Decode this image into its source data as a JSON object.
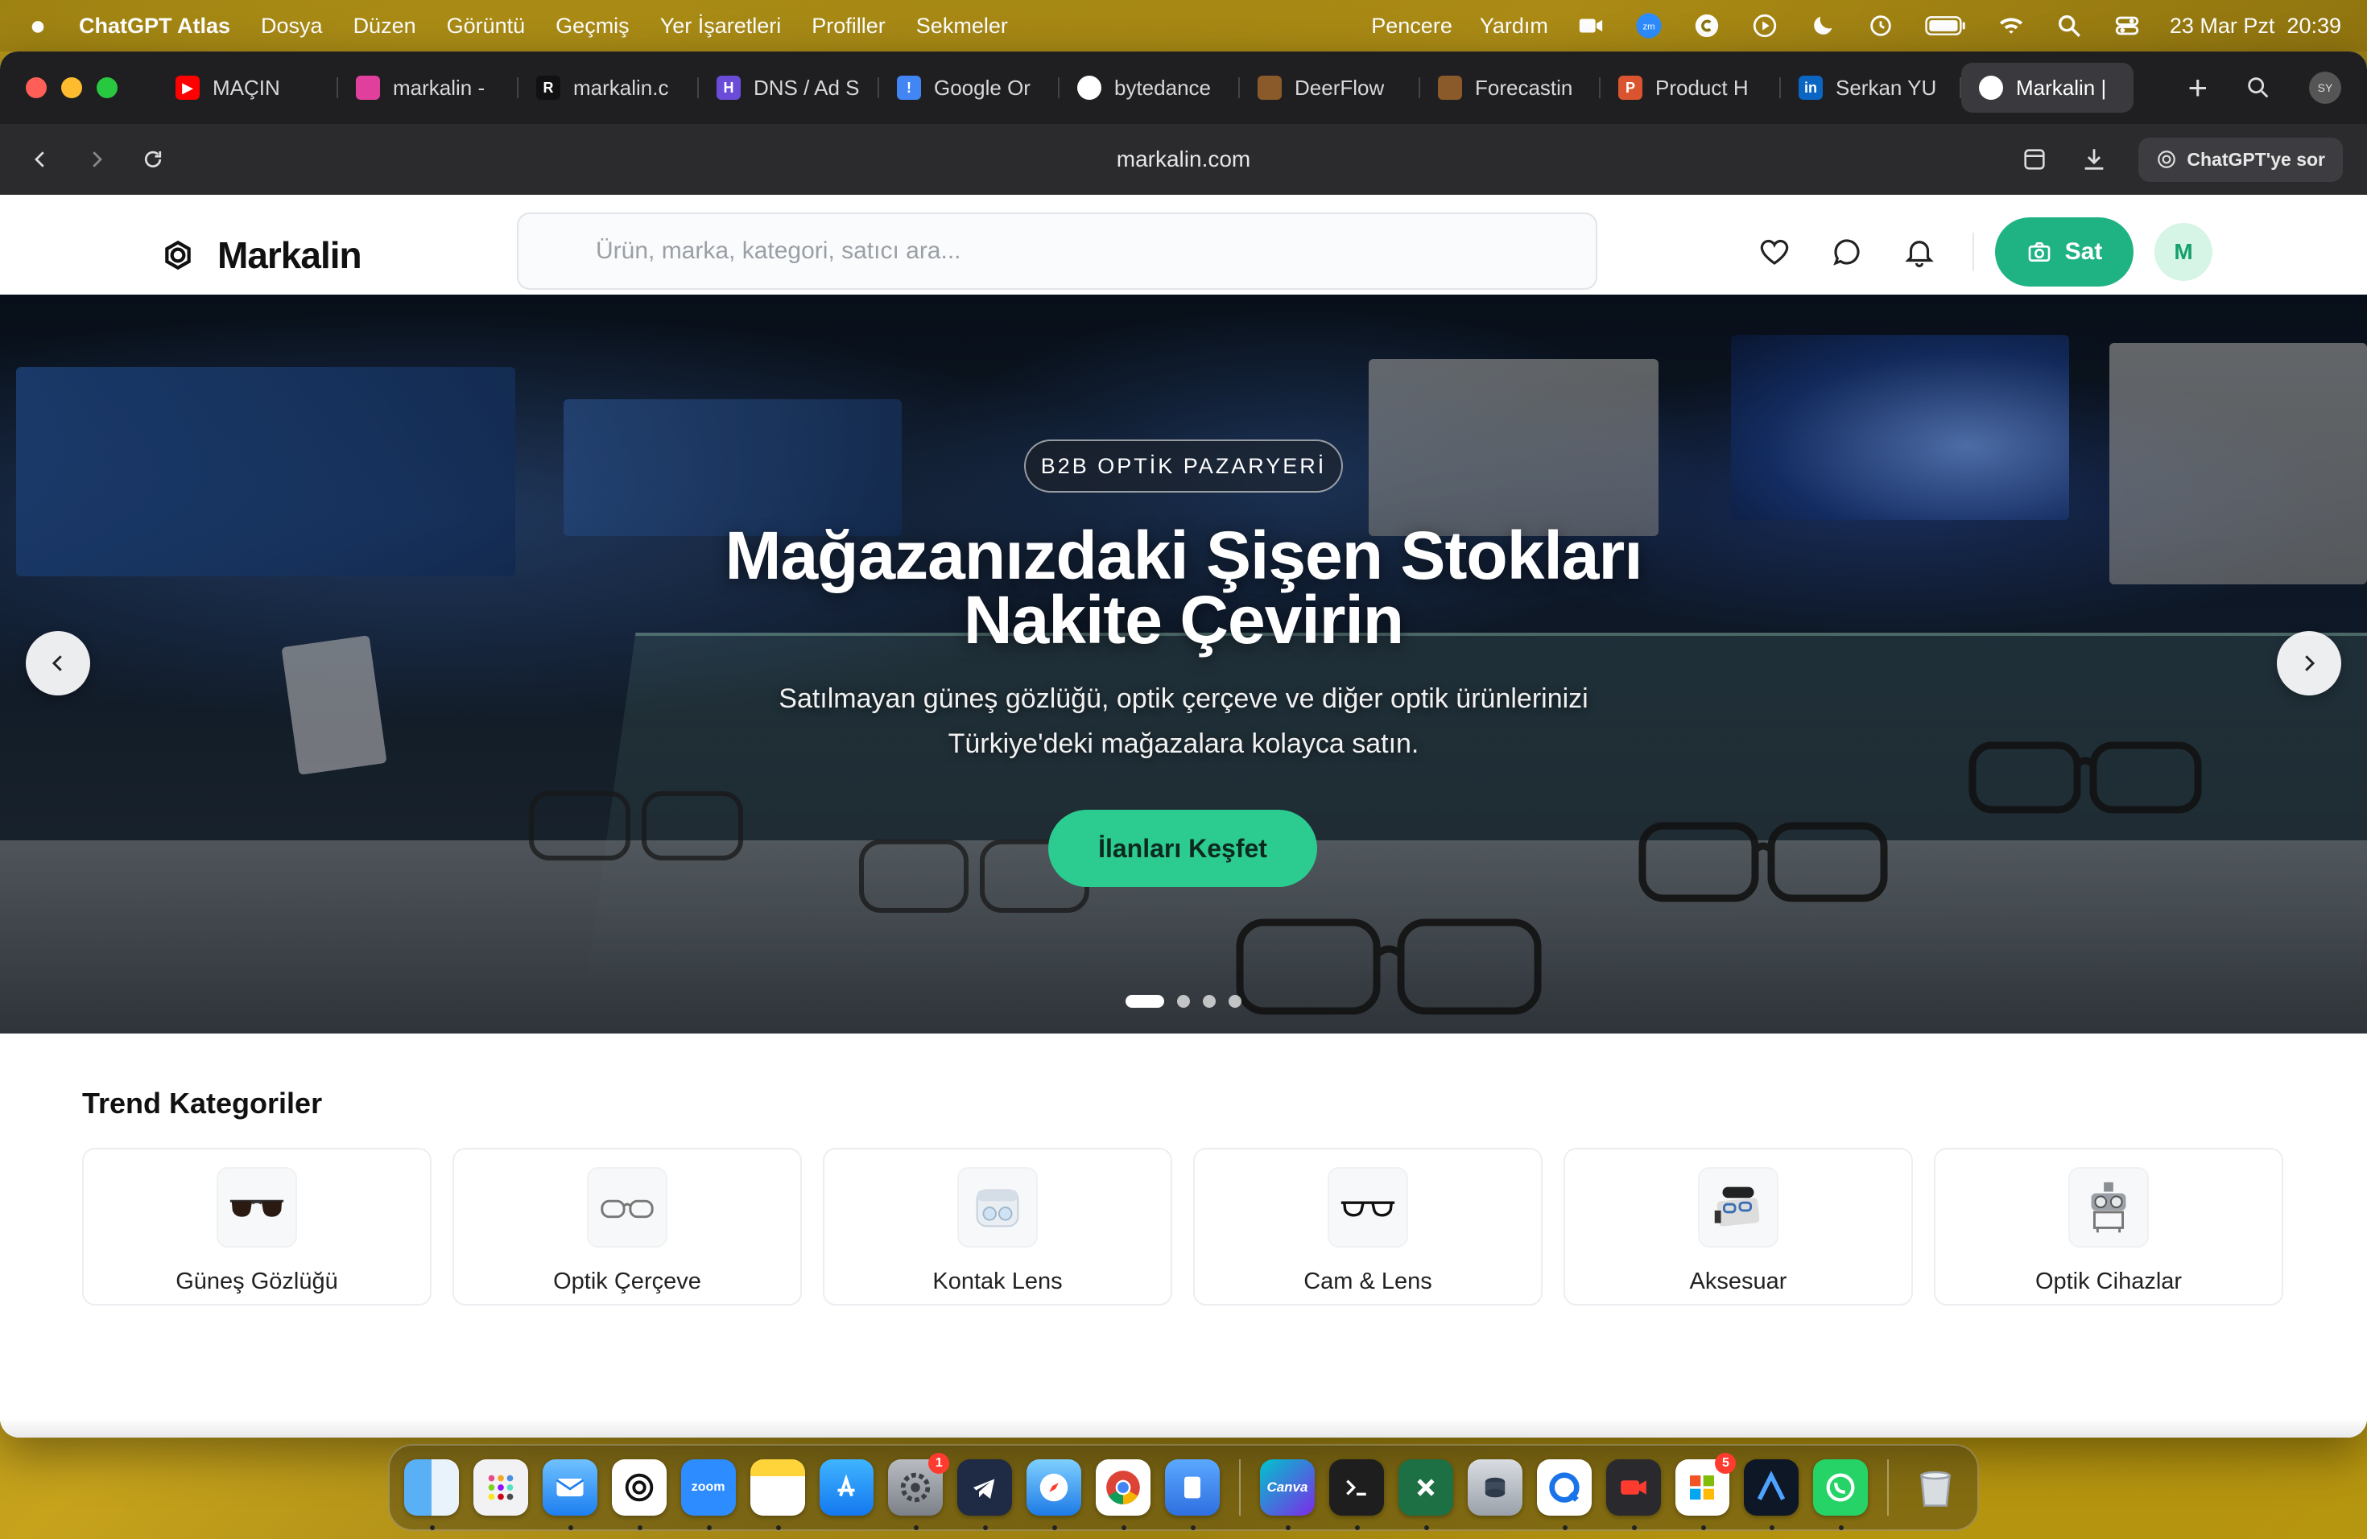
{
  "menubar": {
    "app_name": "ChatGPT Atlas",
    "items": [
      "Dosya",
      "Düzen",
      "Görüntü",
      "Geçmiş",
      "Yer İşaretleri",
      "Profiller",
      "Sekmeler"
    ],
    "right_items": [
      "Pencere",
      "Yardım"
    ],
    "datetime": "23 Mar Pzt  20:39"
  },
  "tabs": [
    {
      "label": "MAÇIN",
      "favicon_color": "#ff0000",
      "favicon_text": "▶"
    },
    {
      "label": "markalin -",
      "favicon_color": "#e0409b",
      "favicon_text": ""
    },
    {
      "label": "markalin.c",
      "favicon_color": "#111111",
      "favicon_text": "R"
    },
    {
      "label": "DNS / Ad S",
      "favicon_color": "#6a4cd8",
      "favicon_text": "H"
    },
    {
      "label": "Google Or",
      "favicon_color": "#4285f4",
      "favicon_text": "!"
    },
    {
      "label": "bytedance",
      "favicon_color": "#ffffff",
      "favicon_text": ""
    },
    {
      "label": "DeerFlow",
      "favicon_color": "#8a5a2b",
      "favicon_text": ""
    },
    {
      "label": "Forecastin",
      "favicon_color": "#8a5a2b",
      "favicon_text": ""
    },
    {
      "label": "Product H",
      "favicon_color": "#da552f",
      "favicon_text": "P"
    },
    {
      "label": "Serkan YU",
      "favicon_color": "#0a66c2",
      "favicon_text": "in"
    },
    {
      "label": "Markalin |",
      "favicon_color": "#ffffff",
      "favicon_text": "",
      "active": true
    }
  ],
  "profile_initials": "SY",
  "browser": {
    "url": "markalin.com",
    "ask_label": "ChatGPT'ye sor"
  },
  "site": {
    "logo_text": "Markalin",
    "search_placeholder": "Ürün, marka, kategori, satıcı ara...",
    "sell_label": "Sat",
    "user_initial": "M",
    "accent_color": "#1fb383"
  },
  "hero": {
    "badge": "B2B OPTİK PAZARYERİ",
    "title_line1": "Mağazanızdaki Şişen Stokları",
    "title_line2": "Nakite Çevirin",
    "subtitle_line1": "Satılmayan güneş gözlüğü, optik çerçeve ve diğer optik ürünlerinizi",
    "subtitle_line2": "Türkiye'deki mağazalara kolayca satın.",
    "cta": "İlanları Keşfet",
    "slide_count": 4,
    "active_slide": 1
  },
  "trend": {
    "title": "Trend Kategoriler",
    "categories": [
      {
        "label": "Güneş Gözlüğü",
        "icon": "sunglasses-icon"
      },
      {
        "label": "Optik Çerçeve",
        "icon": "eyeglass-frame-icon"
      },
      {
        "label": "Kontak Lens",
        "icon": "contact-lens-icon"
      },
      {
        "label": "Cam & Lens",
        "icon": "lens-icon"
      },
      {
        "label": "Aksesuar",
        "icon": "accessory-icon"
      },
      {
        "label": "Optik Cihazlar",
        "icon": "optical-device-icon"
      }
    ]
  },
  "dock": {
    "apps": [
      "Finder",
      "Launchpad",
      "Mail",
      "ChatGPT",
      "Zoom",
      "Notes",
      "App Store",
      "System Settings",
      "Telegram",
      "Safari",
      "Chrome",
      "Preview",
      "Canva",
      "Terminal",
      "Excel",
      "Disk Utility",
      "Quick Share",
      "Recorder",
      "Microsoft Office",
      "Atlas",
      "WhatsApp",
      "Trash"
    ],
    "zoom_label": "zoom",
    "canva_label": "Canva",
    "settings_badge": "1",
    "office_badge": "5"
  }
}
